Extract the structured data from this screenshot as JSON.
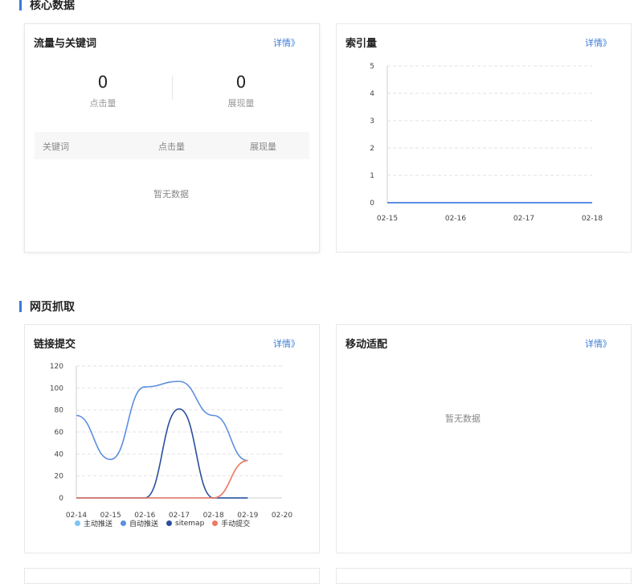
{
  "sections": {
    "core": "核心数据",
    "crawl": "网页抓取"
  },
  "detail_link": "详情》",
  "traffic_card": {
    "title": "流量与关键词",
    "clicks_value": "0",
    "clicks_label": "点击量",
    "impressions_value": "0",
    "impressions_label": "展现量",
    "table_headers": [
      "关键词",
      "点击量",
      "展现量"
    ],
    "empty_text": "暂无数据"
  },
  "index_card": {
    "title": "索引量"
  },
  "link_card": {
    "title": "链接提交"
  },
  "mobile_card": {
    "title": "移动适配",
    "empty_text": "暂无数据"
  },
  "colors": {
    "accent": "#3a7bd5",
    "series_active_push": "#7cc4f5",
    "series_auto_push": "#5b8fe0",
    "series_sitemap": "#2b4f9c",
    "series_manual": "#f07860"
  },
  "chart_data": [
    {
      "type": "line",
      "title": "索引量",
      "x": [
        "02-15",
        "02-16",
        "02-17",
        "02-18"
      ],
      "series": [
        {
          "values": [
            0,
            0,
            0,
            0
          ]
        }
      ],
      "ylim": [
        0,
        5
      ],
      "yticks": [
        "0",
        "1",
        "2",
        "3",
        "4",
        "5"
      ],
      "grid": true
    },
    {
      "type": "line",
      "title": "链接提交",
      "x": [
        "02-14",
        "02-15",
        "02-16",
        "02-17",
        "02-18",
        "02-19",
        "02-20"
      ],
      "yticks": [
        "0",
        "20",
        "40",
        "60",
        "80",
        "100",
        "120"
      ],
      "ylim": [
        0,
        120
      ],
      "grid": true,
      "legend_placement": "bottom",
      "series": [
        {
          "name": "主动推送",
          "values": [
            0,
            0,
            0,
            0,
            0,
            0,
            null
          ]
        },
        {
          "name": "自动推送",
          "values": [
            75,
            35,
            101,
            106,
            75,
            34,
            null
          ]
        },
        {
          "name": "sitemap",
          "values": [
            0,
            0,
            0,
            81,
            0,
            0,
            null
          ]
        },
        {
          "name": "手动提交",
          "values": [
            0,
            0,
            0,
            0,
            0,
            34,
            null
          ]
        }
      ]
    }
  ]
}
